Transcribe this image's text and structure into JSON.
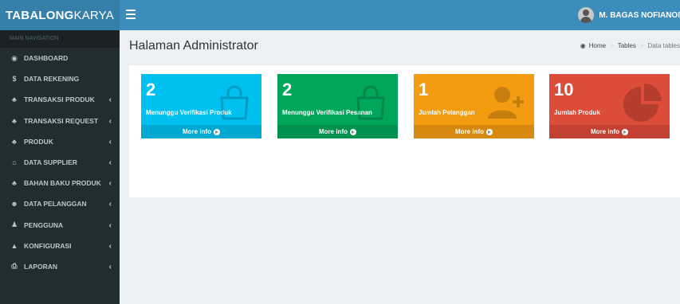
{
  "header": {
    "logo_bold": "TABALONG",
    "logo_light": "KARYA",
    "menu_toggle_icon": "bars-icon",
    "user_name": "M. BAGAS NOFIANOI",
    "colors": {
      "logo_bg": "#367fa9",
      "navbar_bg": "#3c8dbc"
    }
  },
  "sidebar": {
    "header": "MAIN NAVIGATION",
    "items": [
      {
        "label": "DASHBOARD",
        "icon": "dashboard-icon",
        "glyph": "◉",
        "has_caret": false
      },
      {
        "label": "DATA REKENING",
        "icon": "dollar-icon",
        "glyph": "$",
        "has_caret": false
      },
      {
        "label": "TRANSAKSI PRODUK",
        "icon": "sitemap-icon",
        "glyph": "♣",
        "has_caret": true
      },
      {
        "label": "TRANSAKSI REQUEST",
        "icon": "sitemap-icon",
        "glyph": "♣",
        "has_caret": true
      },
      {
        "label": "PRODUK",
        "icon": "sitemap-icon",
        "glyph": "♣",
        "has_caret": true
      },
      {
        "label": "DATA SUPPLIER",
        "icon": "home-icon",
        "glyph": "⌂",
        "has_caret": true
      },
      {
        "label": "BAHAN BAKU PRODUK",
        "icon": "sitemap-icon",
        "glyph": "♣",
        "has_caret": true
      },
      {
        "label": "DATA PELANGGAN",
        "icon": "users-icon",
        "glyph": "☻",
        "has_caret": true
      },
      {
        "label": "PENGGUNA",
        "icon": "user-icon",
        "glyph": "♟",
        "has_caret": true
      },
      {
        "label": "KONFIGURASI",
        "icon": "lock-icon",
        "glyph": "▲",
        "has_caret": true
      },
      {
        "label": "LAPORAN",
        "icon": "print-icon",
        "glyph": "⎙",
        "has_caret": true
      }
    ],
    "caret_glyph": "‹"
  },
  "content": {
    "title": "Halaman Administrator",
    "breadcrumb": {
      "home": "Home",
      "tables": "Tables",
      "current": "Data tables"
    }
  },
  "stats": [
    {
      "value": "2",
      "label": "Menunggu Verifikasi Produk",
      "more": "More info",
      "color": "#00c0ef",
      "icon": "shopping-bag-icon"
    },
    {
      "value": "2",
      "label": "Menunggu Verifikasi Pesanan",
      "more": "More info",
      "color": "#00a65a",
      "icon": "shopping-bag-icon"
    },
    {
      "value": "1",
      "label": "Jumlah Pelanggan",
      "more": "More info",
      "color": "#f39c12",
      "icon": "user-plus-icon"
    },
    {
      "value": "10",
      "label": "Jumlah Produk",
      "more": "More info",
      "color": "#dd4b39",
      "icon": "pie-chart-icon"
    }
  ]
}
